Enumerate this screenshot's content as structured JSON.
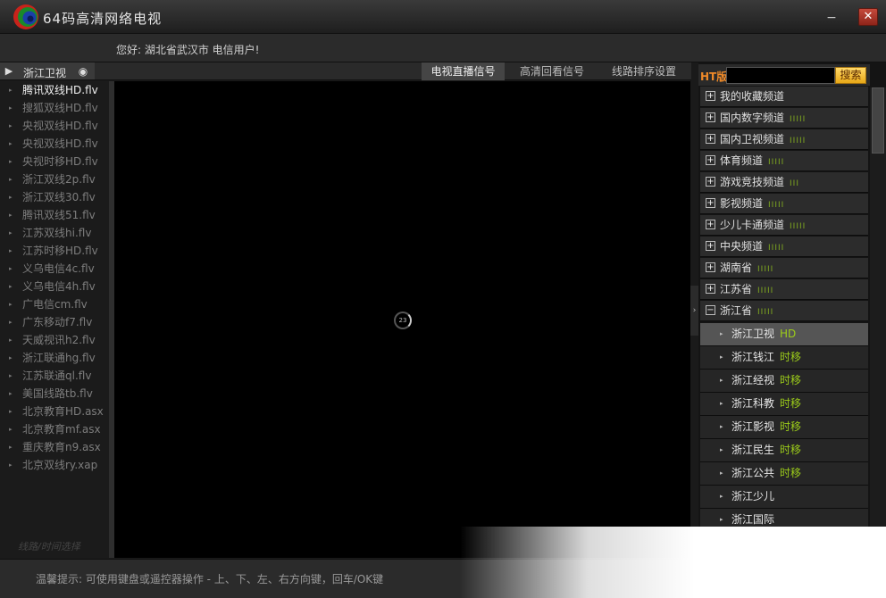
{
  "app": {
    "title": "64码高清网络电视",
    "close_glyph": "✕",
    "minimize_glyph": "−"
  },
  "greeting": "您好: 湖北省武汉市 电信用户!",
  "left_header": {
    "label": "浙江卫视"
  },
  "mid_tabs": [
    {
      "label": "电视直播信号",
      "active": true
    },
    {
      "label": "高清回看信号",
      "active": false
    },
    {
      "label": "线路排序设置",
      "active": false
    }
  ],
  "left_list": [
    {
      "label": "腾讯双线HD.flv",
      "active": true
    },
    {
      "label": "搜狐双线HD.flv",
      "active": false
    },
    {
      "label": "央视双线HD.flv",
      "active": false
    },
    {
      "label": "央视双线HD.flv",
      "active": false
    },
    {
      "label": "央视时移HD.flv",
      "active": false
    },
    {
      "label": "浙江双线2p.flv",
      "active": false
    },
    {
      "label": "浙江双线30.flv",
      "active": false
    },
    {
      "label": "腾讯双线51.flv",
      "active": false
    },
    {
      "label": "江苏双线hi.flv",
      "active": false
    },
    {
      "label": "江苏时移HD.flv",
      "active": false
    },
    {
      "label": "义乌电信4c.flv",
      "active": false
    },
    {
      "label": "义乌电信4h.flv",
      "active": false
    },
    {
      "label": "广电信cm.flv",
      "active": false
    },
    {
      "label": "广东移动f7.flv",
      "active": false
    },
    {
      "label": "天威视讯h2.flv",
      "active": false
    },
    {
      "label": "浙江联通hg.flv",
      "active": false
    },
    {
      "label": "江苏联通ql.flv",
      "active": false
    },
    {
      "label": "美国线路tb.flv",
      "active": false
    },
    {
      "label": "北京教育HD.asx",
      "active": false
    },
    {
      "label": "北京教育mf.asx",
      "active": false
    },
    {
      "label": "重庆教育n9.asx",
      "active": false
    },
    {
      "label": "北京双线ry.xap",
      "active": false
    }
  ],
  "left_footer": "线路/时间选择",
  "video": {
    "loading_value": "23"
  },
  "search": {
    "edition_label": "HT版",
    "button_label": "搜索",
    "placeholder": ""
  },
  "categories": [
    {
      "label": "我的收藏频道",
      "bars": "",
      "expanded": false
    },
    {
      "label": "国内数字频道",
      "bars": "IIIII",
      "expanded": false
    },
    {
      "label": "国内卫视频道",
      "bars": "IIIII",
      "expanded": false
    },
    {
      "label": "体育频道",
      "bars": "IIIII",
      "expanded": false
    },
    {
      "label": "游戏竞技频道",
      "bars": "III",
      "expanded": false
    },
    {
      "label": "影视频道",
      "bars": "IIIII",
      "expanded": false
    },
    {
      "label": "少儿卡通频道",
      "bars": "IIIII",
      "expanded": false
    },
    {
      "label": "中央频道",
      "bars": "IIIII",
      "expanded": false
    },
    {
      "label": "湖南省",
      "bars": "IIIII",
      "expanded": false
    },
    {
      "label": "江苏省",
      "bars": "IIIII",
      "expanded": false
    },
    {
      "label": "浙江省",
      "bars": "IIIII",
      "expanded": true
    }
  ],
  "channels": [
    {
      "label": "浙江卫视",
      "tag": "HD",
      "active": true
    },
    {
      "label": "浙江钱江",
      "tag": "时移",
      "active": false
    },
    {
      "label": "浙江经视",
      "tag": "时移",
      "active": false
    },
    {
      "label": "浙江科教",
      "tag": "时移",
      "active": false
    },
    {
      "label": "浙江影视",
      "tag": "时移",
      "active": false
    },
    {
      "label": "浙江民生",
      "tag": "时移",
      "active": false
    },
    {
      "label": "浙江公共",
      "tag": "时移",
      "active": false
    },
    {
      "label": "浙江少儿",
      "tag": "",
      "active": false
    },
    {
      "label": "浙江国际",
      "tag": "",
      "active": false
    }
  ],
  "tip": "温馨提示:  可使用键盘或遥控器操作  - 上、下、左、右方向键，回车/OK键",
  "colors": {
    "accent_orange": "#f08a28",
    "tag_green": "#9ccc1a",
    "close_red": "#b33a2c"
  }
}
